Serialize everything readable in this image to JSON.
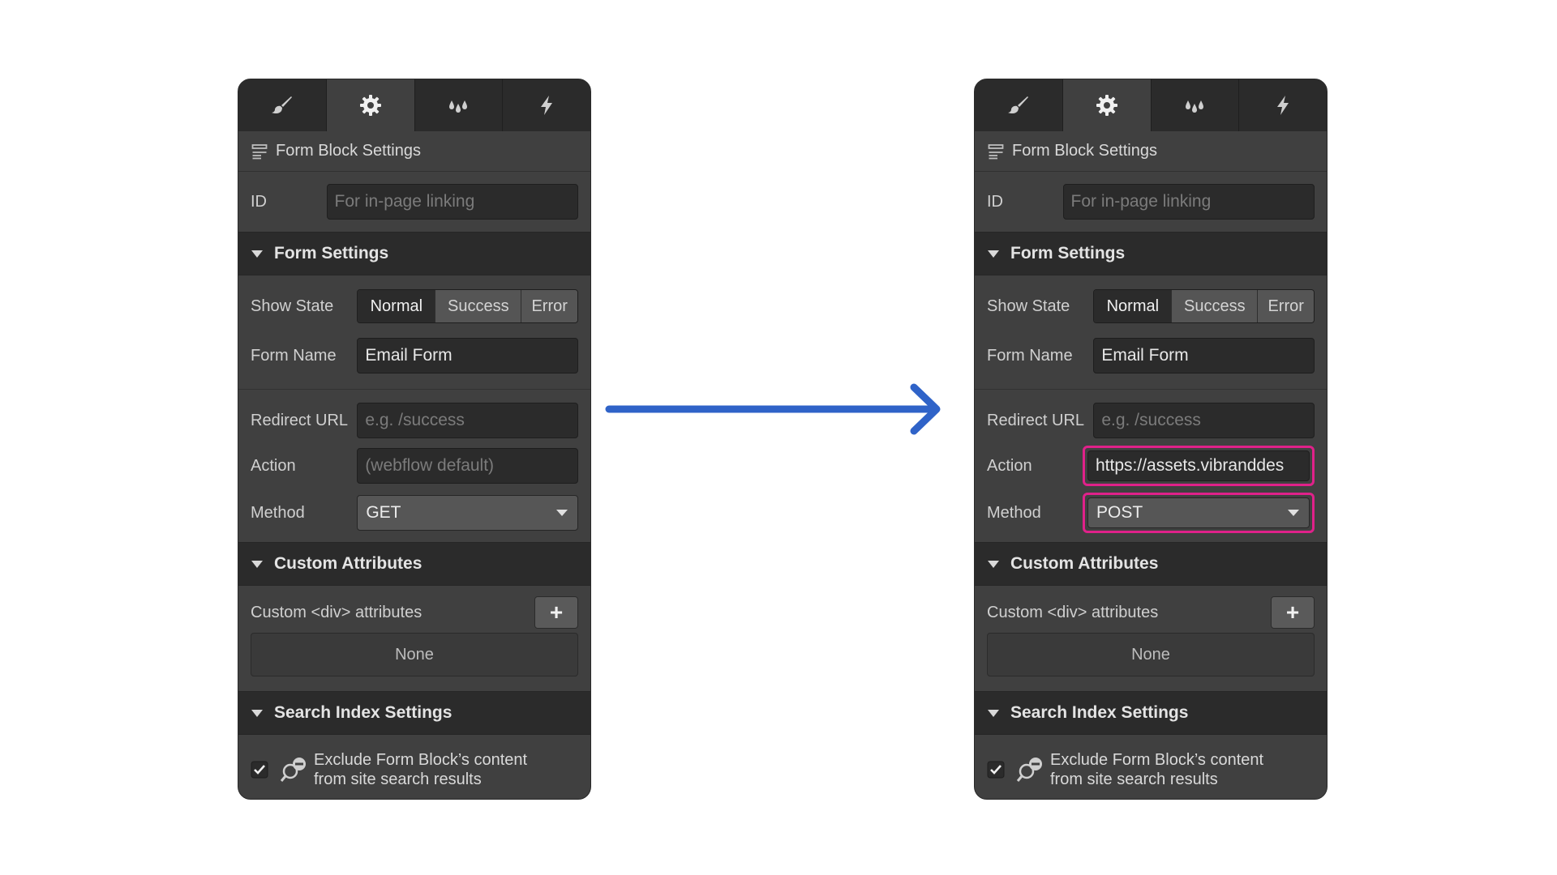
{
  "before": {
    "block_title": "Form Block Settings",
    "id_label": "ID",
    "id_placeholder": "For in-page linking",
    "form_settings_title": "Form Settings",
    "show_state_label": "Show State",
    "states": [
      "Normal",
      "Success",
      "Error"
    ],
    "form_name_label": "Form Name",
    "form_name_value": "Email Form",
    "redirect_label": "Redirect URL",
    "redirect_placeholder": "e.g. /success",
    "action_label": "Action",
    "action_placeholder": "(webflow default)",
    "action_value": "",
    "method_label": "Method",
    "method_value": "GET",
    "custom_attrs_title": "Custom Attributes",
    "custom_div_label": "Custom <div> attributes",
    "add_symbol": "+",
    "none_text": "None",
    "search_index_title": "Search Index Settings",
    "exclude_line1": "Exclude Form Block’s content",
    "exclude_line2": "from site search results"
  },
  "after": {
    "block_title": "Form Block Settings",
    "id_label": "ID",
    "id_placeholder": "For in-page linking",
    "form_settings_title": "Form Settings",
    "show_state_label": "Show State",
    "states": [
      "Normal",
      "Success",
      "Error"
    ],
    "form_name_label": "Form Name",
    "form_name_value": "Email Form",
    "redirect_label": "Redirect URL",
    "redirect_placeholder": "e.g. /success",
    "action_label": "Action",
    "action_value": "https://assets.vibranddes",
    "method_label": "Method",
    "method_value": "POST",
    "custom_attrs_title": "Custom Attributes",
    "custom_div_label": "Custom <div> attributes",
    "add_symbol": "+",
    "none_text": "None",
    "search_index_title": "Search Index Settings",
    "exclude_line1": "Exclude Form Block’s content",
    "exclude_line2": "from site search results"
  },
  "colors": {
    "panel_bg": "#404040",
    "dark_bg": "#2b2b2b",
    "highlight": "#e0218a",
    "arrow": "#2f63c8"
  },
  "icons": [
    "brush-icon",
    "gear-icon",
    "drops-icon",
    "lightning-icon",
    "form-block-icon",
    "checkbox-icon",
    "search-exclude-icon"
  ]
}
